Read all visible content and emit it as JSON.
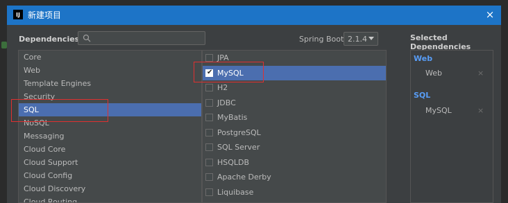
{
  "window": {
    "title": "新建项目",
    "close_label": "×"
  },
  "toolbar": {
    "dependencies_label": "Dependencies",
    "search_placeholder": "",
    "spring_boot_label": "Spring Boot",
    "spring_boot_version": "2.1.4"
  },
  "categories": [
    "Core",
    "Web",
    "Template Engines",
    "Security",
    "SQL",
    "NoSQL",
    "Messaging",
    "Cloud Core",
    "Cloud Support",
    "Cloud Config",
    "Cloud Discovery",
    "Cloud Routing"
  ],
  "selected_category": "SQL",
  "dependencies": [
    {
      "label": "JPA",
      "checked": false
    },
    {
      "label": "MySQL",
      "checked": true
    },
    {
      "label": "H2",
      "checked": false
    },
    {
      "label": "JDBC",
      "checked": false
    },
    {
      "label": "MyBatis",
      "checked": false
    },
    {
      "label": "PostgreSQL",
      "checked": false
    },
    {
      "label": "SQL Server",
      "checked": false
    },
    {
      "label": "HSQLDB",
      "checked": false
    },
    {
      "label": "Apache Derby",
      "checked": false
    },
    {
      "label": "Liquibase",
      "checked": false
    }
  ],
  "selected_panel": {
    "title": "Selected Dependencies",
    "groups": [
      {
        "name": "Web",
        "items": [
          "Web"
        ]
      },
      {
        "name": "SQL",
        "items": [
          "MySQL"
        ]
      }
    ],
    "remove_label": "×"
  },
  "colors": {
    "accent": "#4b6eaf",
    "titlebar": "#1d74c7",
    "highlight_box": "#e03030",
    "group_title": "#589df6"
  }
}
